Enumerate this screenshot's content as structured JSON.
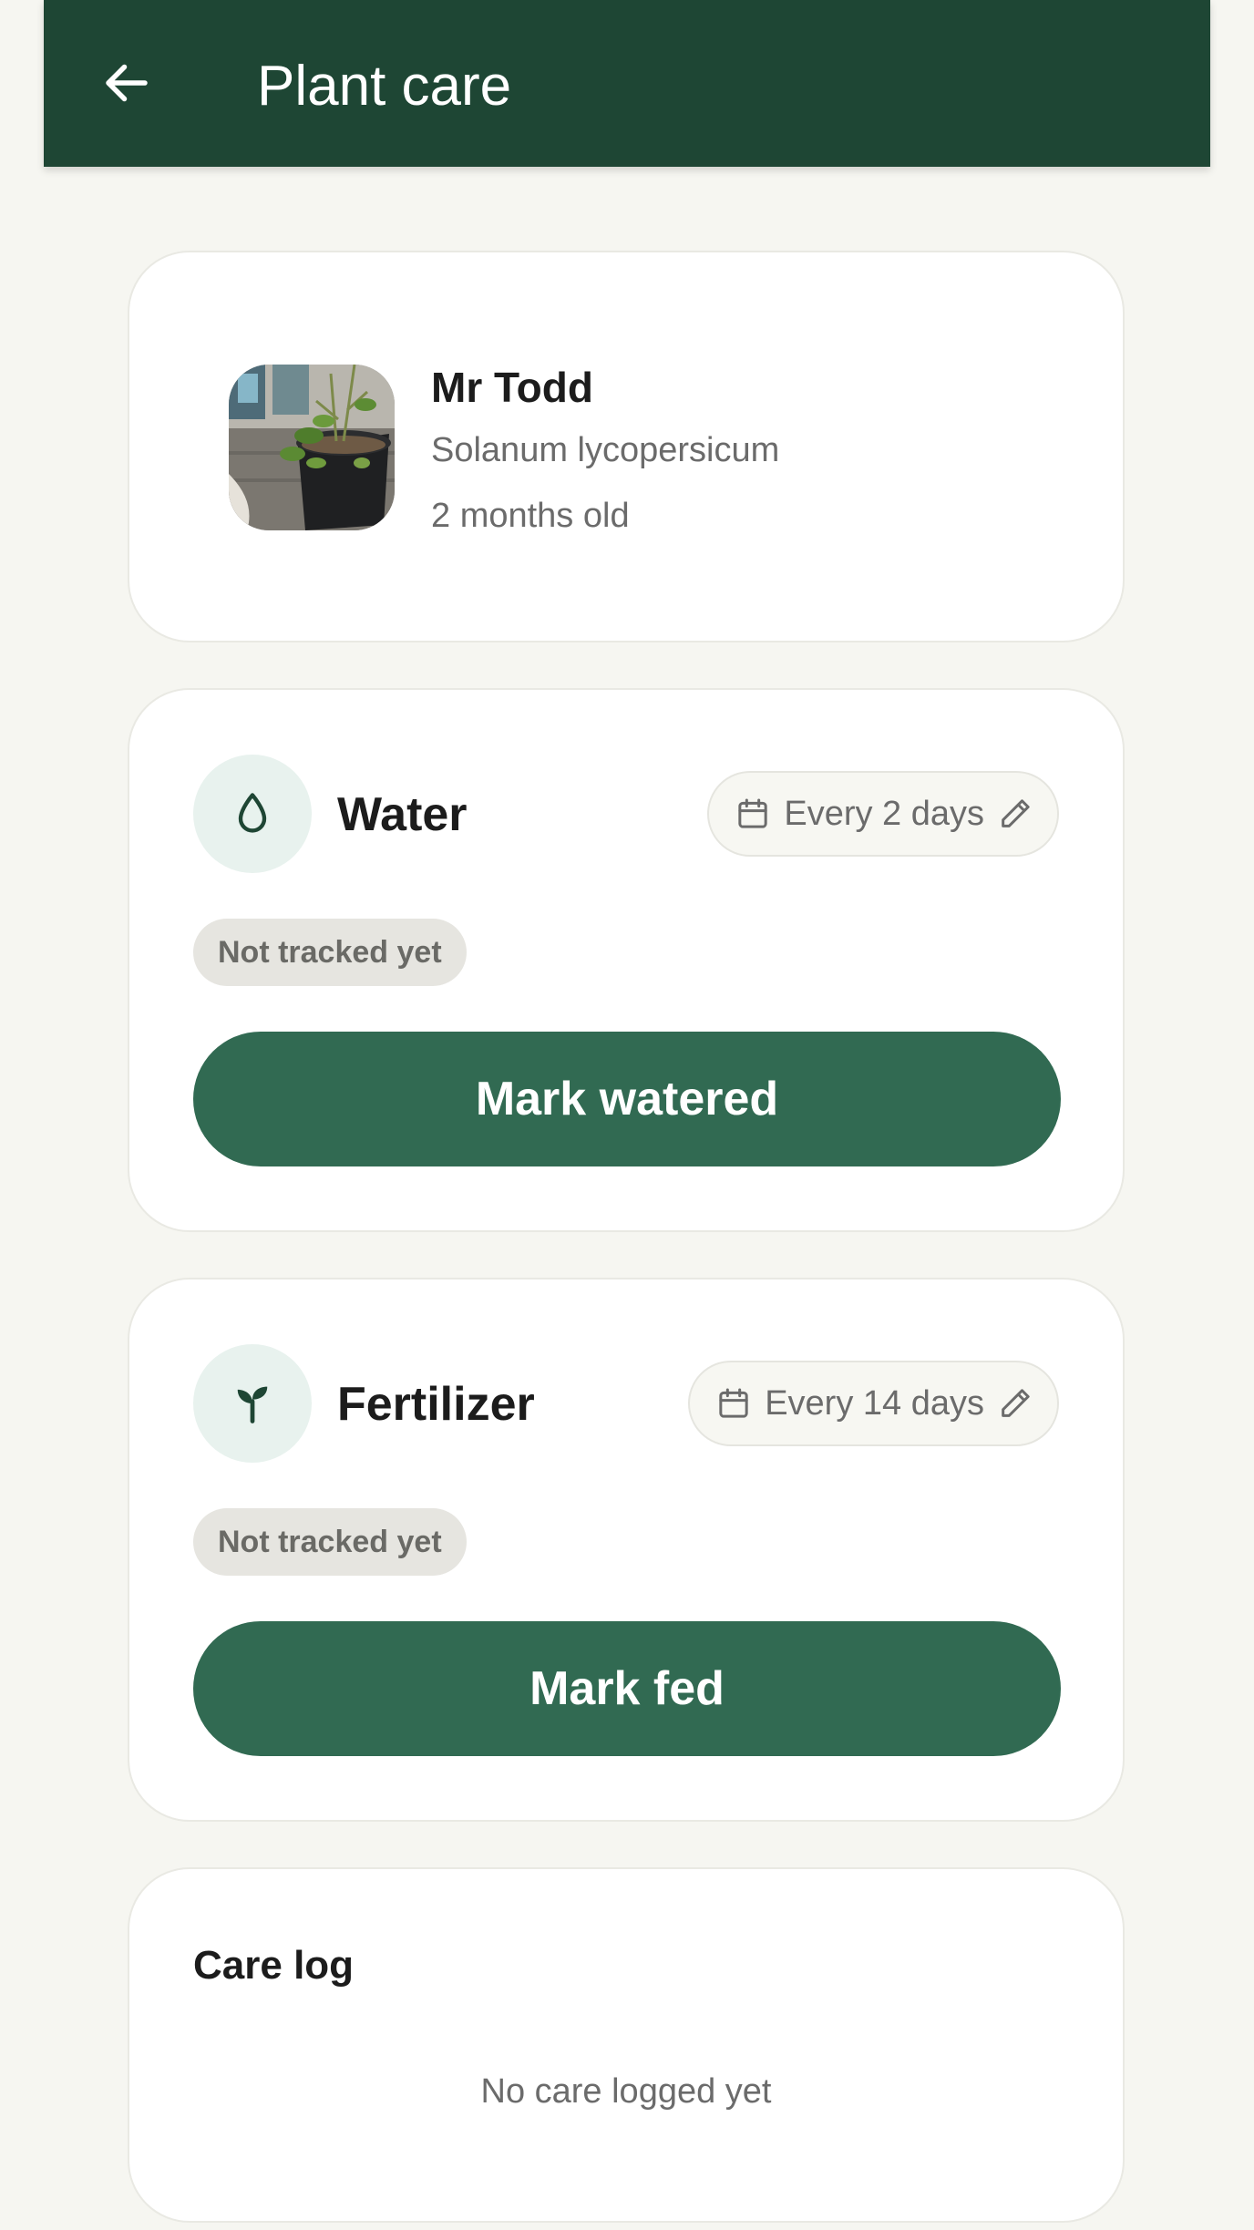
{
  "colors": {
    "app_bar": "#1e4634",
    "background": "#f6f6f1",
    "button": "#316a52",
    "icon": "#1e4634",
    "icon_circle": "#e8f2ee",
    "pill": "#e6e5e0"
  },
  "header": {
    "title": "Plant care",
    "back_icon": "arrow-left-icon"
  },
  "plant": {
    "name": "Mr Todd",
    "species": "Solanum lycopersicum",
    "age": "2 months old",
    "photo_icon": "plant-photo"
  },
  "tasks": [
    {
      "title": "Water",
      "icon": "water-drop-icon",
      "schedule": "Every 2 days",
      "status": "Not tracked yet",
      "action": "Mark watered"
    },
    {
      "title": "Fertilizer",
      "icon": "sprout-icon",
      "schedule": "Every 14 days",
      "status": "Not tracked yet",
      "action": "Mark fed"
    }
  ],
  "care_log": {
    "title": "Care log",
    "empty_text": "No care logged yet"
  }
}
